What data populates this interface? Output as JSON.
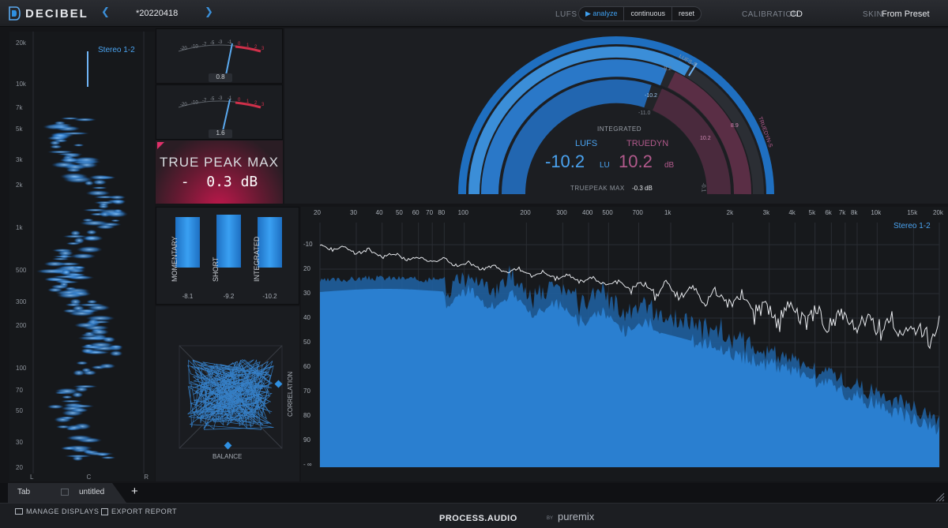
{
  "app": {
    "brand": "DECIBEL",
    "preset": "*20220418"
  },
  "topbar": {
    "lufs_label": "LUFS",
    "analyze": "▶ analyze",
    "continuous": "continuous",
    "reset": "reset",
    "calibration_label": "CALIBRATION:",
    "calibration_value": "CD",
    "skin_label": "SKIN:",
    "skin_value": "From Preset"
  },
  "spectrogram": {
    "channel": "Stereo 1-2",
    "freq_labels": [
      "20k",
      "10k",
      "7k",
      "5k",
      "3k",
      "2k",
      "1k",
      "500",
      "300",
      "200",
      "100",
      "70",
      "50",
      "30",
      "20"
    ],
    "lr": [
      "L",
      "C",
      "R"
    ]
  },
  "vu": {
    "scale": [
      "-20",
      "-10",
      "-7",
      "-5",
      "-3",
      "-1",
      "0",
      "1",
      "2",
      "3"
    ],
    "meter1_value": "0.8",
    "meter2_value": "1.6"
  },
  "true_peak": {
    "title": "TRUE PEAK MAX",
    "value": "-  0.3 dB"
  },
  "bars": {
    "labels": [
      "MOMENTARY",
      "SHORT",
      "INTEGRATED"
    ],
    "values": [
      "-8.1",
      "-9.2",
      "-10.2"
    ],
    "levels": [
      0.85,
      0.89,
      0.85
    ]
  },
  "gonio": {
    "correlation": "CORRELATION",
    "balance": "BALANCE"
  },
  "loudness": {
    "integrated_label": "INTEGRATED",
    "lufs_label": "LUFS",
    "truedyn_label": "TRUEDYN",
    "lufs_value": "-10.2",
    "lufs_unit": "LU",
    "truedyn_value": "10.2",
    "truedyn_unit": "dB",
    "truepeak_label": "TRUEPEAK MAX",
    "truepeak_value": "-0.3 dB",
    "arc_marks": [
      "-9.2",
      "-10.2",
      "-11.0",
      "8.9",
      "10.2",
      "-0.1"
    ],
    "arc_side_labels": [
      "LUFS-S",
      "TRUEDYN-S"
    ]
  },
  "spectrum": {
    "channel": "Stereo 1-2",
    "freq_labels": [
      "20",
      "30",
      "40",
      "50",
      "60",
      "70",
      "80",
      "100",
      "200",
      "300",
      "400",
      "500",
      "700",
      "1k",
      "2k",
      "3k",
      "4k",
      "5k",
      "6k",
      "7k",
      "8k",
      "10k",
      "15k",
      "20k"
    ],
    "db_labels": [
      "-10",
      "20",
      "30",
      "40",
      "50",
      "60",
      "70",
      "80",
      "90",
      "- ∞"
    ]
  },
  "tabs": {
    "tab1": "Tab",
    "tab2": "untitled",
    "add": "+"
  },
  "footer": {
    "manage": "MANAGE DISPLAYS",
    "export": "EXPORT REPORT",
    "brand1": "PROCESS.AUDIO",
    "by": "BY",
    "brand2": "puremix"
  },
  "colors": {
    "accent": "#2f8fe0",
    "bg": "#141518",
    "truepeak": "#c0184c",
    "truedyn": "#b25a8c"
  }
}
